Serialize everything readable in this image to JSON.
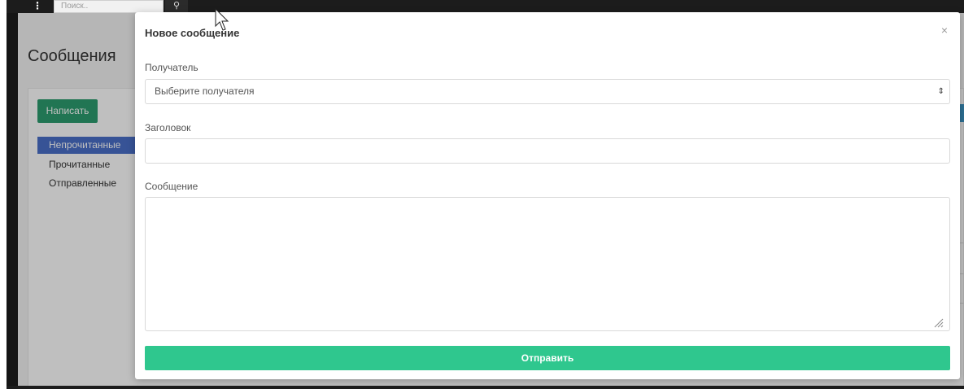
{
  "topbar": {
    "menu_icon": "vertical-dots-icon",
    "search_placeholder": "Поиск..",
    "search_icon": "search-icon"
  },
  "page": {
    "title": "Сообщения",
    "write_button": "Написать",
    "folders": [
      {
        "label": "Непрочитанные",
        "active": true
      },
      {
        "label": "Прочитанные",
        "active": false
      },
      {
        "label": "Отправленные",
        "active": false
      }
    ],
    "colors": {
      "write_button": "#2d9d6f",
      "active_folder": "#4a6fc8"
    }
  },
  "modal": {
    "title": "Новое сообщение",
    "close_icon": "close-icon",
    "recipient_label": "Получатель",
    "recipient_value": "Выберите получателя",
    "subject_label": "Заголовок",
    "subject_value": "",
    "message_label": "Сообщение",
    "message_value": "",
    "send_button": "Отправить",
    "colors": {
      "send_button": "#2fc78e"
    }
  }
}
